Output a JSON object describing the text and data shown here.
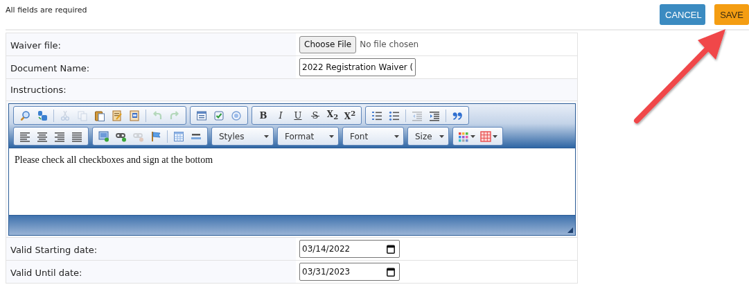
{
  "header": {
    "note": "All fields are required",
    "buttons": [
      {
        "label": "CANCEL",
        "kind": "cancel"
      },
      {
        "label": "SAVE",
        "kind": "save"
      }
    ]
  },
  "form": {
    "rows": [
      {
        "kind": "file",
        "label": "Waiver file:",
        "button": "Choose File",
        "status": "No file chosen"
      },
      {
        "kind": "text",
        "label": "Document Name:",
        "value": "2022 Registration Waiver ("
      },
      {
        "kind": "editor",
        "label": "Instructions:"
      },
      {
        "kind": "date",
        "label": "Valid Starting date:",
        "value": "03/14/2022"
      },
      {
        "kind": "date",
        "label": "Valid Until date:",
        "value": "03/31/2023"
      }
    ]
  },
  "editor": {
    "toolbar": [
      [
        [
          {
            "kind": "icon",
            "disabled": false
          },
          {
            "kind": "icon",
            "disabled": false
          },
          {
            "kind": "sep"
          },
          {
            "kind": "icon",
            "disabled": true
          },
          {
            "kind": "icon",
            "disabled": true
          },
          {
            "kind": "icon",
            "disabled": false
          },
          {
            "kind": "icon",
            "disabled": false
          },
          {
            "kind": "icon",
            "disabled": false
          },
          {
            "kind": "sep"
          },
          {
            "kind": "icon",
            "disabled": true
          },
          {
            "kind": "icon",
            "disabled": true
          }
        ],
        [
          {
            "kind": "icon",
            "disabled": false
          },
          {
            "kind": "icon",
            "disabled": false
          },
          {
            "kind": "icon",
            "disabled": false
          }
        ],
        [
          {
            "kind": "glyph",
            "text": "B"
          },
          {
            "kind": "glyph",
            "text": "I"
          },
          {
            "kind": "glyph",
            "text": "U"
          },
          {
            "kind": "glyph",
            "text": "S"
          },
          {
            "kind": "glyph",
            "text": "X$_{2}$"
          },
          {
            "kind": "glyph",
            "text": "X$^{2}$"
          }
        ],
        [
          {
            "kind": "icon",
            "disabled": false
          },
          {
            "kind": "icon",
            "disabled": false
          },
          {
            "kind": "sep"
          },
          {
            "kind": "icon",
            "disabled": true
          },
          {
            "kind": "icon",
            "disabled": false
          },
          {
            "kind": "sep"
          },
          {
            "kind": "icon",
            "disabled": false
          }
        ]
      ],
      [
        [
          {
            "kind": "icon",
            "disabled": false
          },
          {
            "kind": "icon",
            "disabled": false
          },
          {
            "kind": "icon",
            "disabled": false
          },
          {
            "kind": "icon",
            "disabled": false
          }
        ],
        [
          {
            "kind": "icon",
            "disabled": false
          },
          {
            "kind": "icon",
            "disabled": false
          },
          {
            "kind": "icon",
            "disabled": true
          },
          {
            "kind": "icon",
            "disabled": false
          },
          {
            "kind": "sep"
          },
          {
            "kind": "icon",
            "disabled": false
          },
          {
            "kind": "icon",
            "disabled": false
          }
        ],
        [
          {
            "kind": "dropdown",
            "label": "Styles"
          }
        ],
        [
          {
            "kind": "dropdown",
            "label": "Format"
          }
        ],
        [
          {
            "kind": "dropdown",
            "label": "Font"
          }
        ],
        [
          {
            "kind": "dropdown",
            "label": "Size"
          }
        ],
        [
          {
            "kind": "iconmenu",
            "disabled": false
          },
          {
            "kind": "iconmenu",
            "disabled": false
          }
        ]
      ]
    ],
    "content": "Please check all checkboxes and sign at the bottom"
  }
}
